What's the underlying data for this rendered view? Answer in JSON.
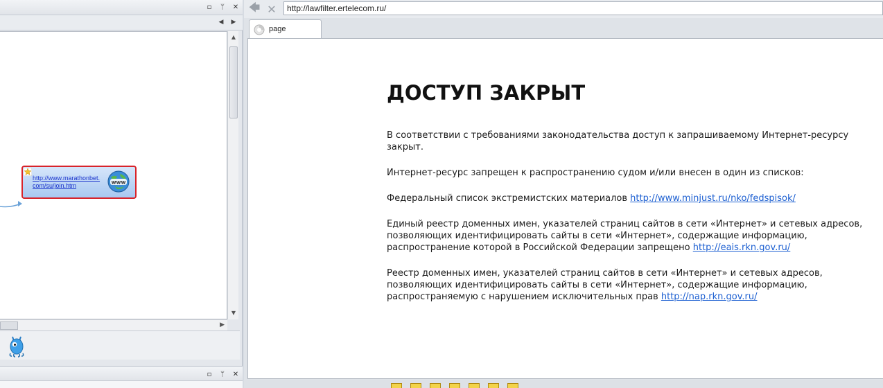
{
  "browser": {
    "address": "http://lawfilter.ertelecom.ru/",
    "tab_label": "page"
  },
  "mindmap": {
    "node_link": "http://www.marathonbet.com/su/join.htm"
  },
  "page": {
    "heading": "ДОСТУП ЗАКРЫТ",
    "intro": "В соответствии с требованиями законодательства доступ к запрашиваемому Интернет-ресурсу закрыт.",
    "reason": "Интернет-ресурс запрещен к распространению судом и/или внесен в один из списков:",
    "item1_text": "Федеральный список экстремистских материалов ",
    "item1_link": "http://www.minjust.ru/nko/fedspisok/",
    "item2_text": "Единый реестр доменных имен, указателей страниц сайтов в сети «Интернет» и сетевых адресов, позволяющих идентифицировать сайты в сети «Интернет», содержащие информацию, распространение которой в Российской Федерации запрещено ",
    "item2_link": "http://eais.rkn.gov.ru/",
    "item3_text": "Реестр доменных имен, указателей страниц сайтов в сети «Интернет» и сетевых адресов, позволяющих идентифицировать сайты в сети «Интернет», содержащие информацию, распространяемую с нарушением исключительных прав ",
    "item3_link": "http://nap.rkn.gov.ru/"
  }
}
